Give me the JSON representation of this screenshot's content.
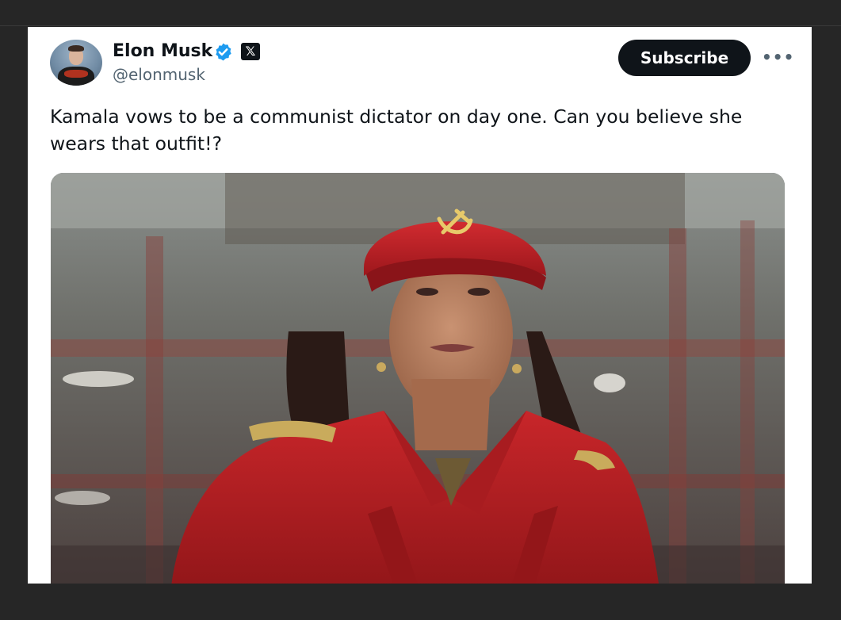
{
  "post": {
    "author_name": "Elon Musk",
    "author_handle": "@elonmusk",
    "verified": true,
    "x_badge": "𝕏",
    "subscribe_label": "Subscribe",
    "more_label": "•••",
    "text": "Kamala vows to be a communist dictator on day one. Can you believe she wears that outfit!?"
  },
  "icons": {
    "verified": "verified-badge-icon",
    "x_logo": "x-logo-icon",
    "more": "more-options-icon"
  },
  "colors": {
    "background": "#262626",
    "card": "#ffffff",
    "text_primary": "#0f1419",
    "text_secondary": "#536471",
    "verified_blue": "#1d9bf0",
    "button": "#0f1419"
  }
}
